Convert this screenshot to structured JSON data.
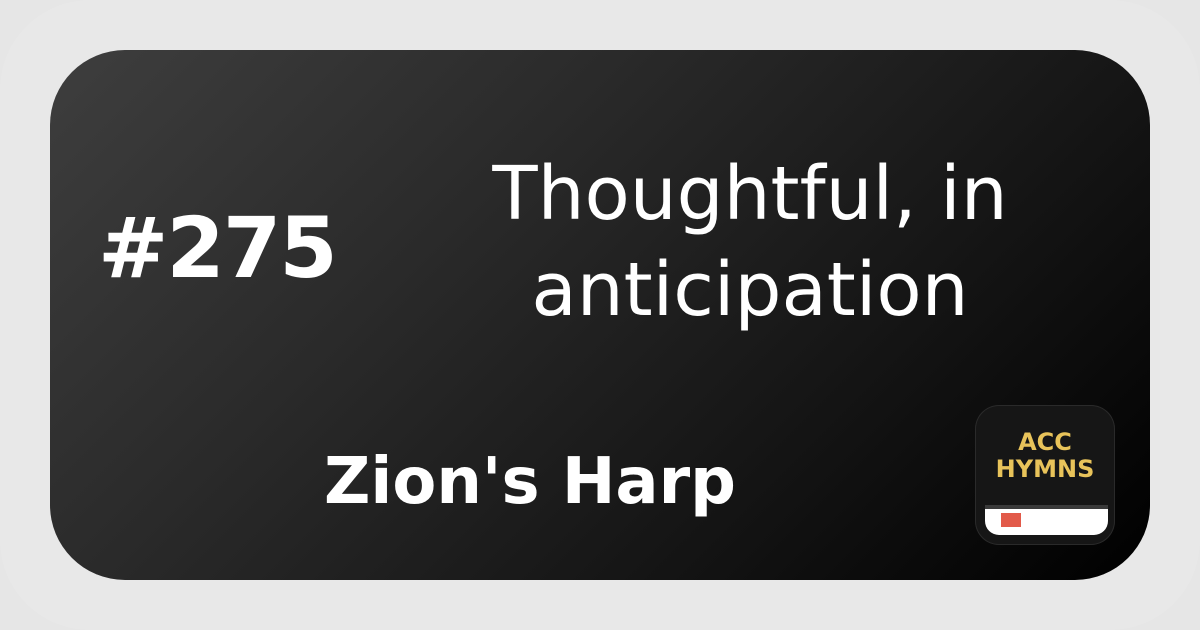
{
  "hymn": {
    "number": "#275",
    "title_line1": "Thoughtful, in",
    "title_line2": "anticipation",
    "hymnal": "Zion's Harp"
  },
  "logo": {
    "line1": "ACC",
    "line2": "HYMNS",
    "icon": "book-bookmark-icon",
    "text_color": "#e8c35a",
    "bookmark_color": "#e25a4a"
  },
  "colors": {
    "frame": "#e8e8e8",
    "card_gradient_start": "#3e3e3e",
    "card_gradient_end": "#000000",
    "text": "#ffffff"
  }
}
